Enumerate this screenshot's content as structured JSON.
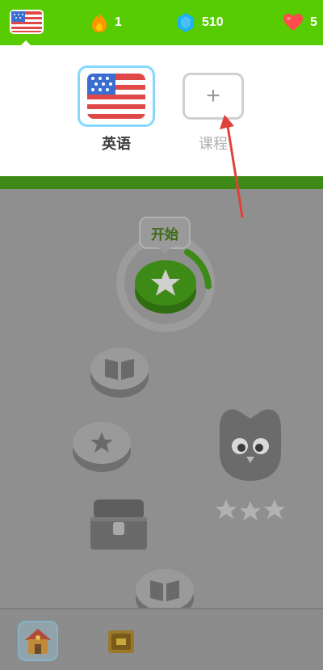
{
  "header": {
    "stats": [
      {
        "name": "streak",
        "value": "1",
        "icon": "flame-icon",
        "color": "#ff9600"
      },
      {
        "name": "gems",
        "value": "510",
        "icon": "gem-icon",
        "color": "#1cb0f6"
      },
      {
        "name": "hearts",
        "value": "5",
        "icon": "heart-icon",
        "color": "#ff4b4b"
      }
    ]
  },
  "course_menu": {
    "courses": [
      {
        "label": "英语",
        "flag": "us-flag-icon",
        "selected": true
      }
    ],
    "add_course_label": "课程",
    "add_course_symbol": "+"
  },
  "path": {
    "start_bubble_label": "开始"
  },
  "colors": {
    "brand_green": "#58cc02",
    "dark_green": "#3e8a16",
    "selection_blue": "#84d8ff",
    "annotation_arrow": "#e0413b"
  }
}
